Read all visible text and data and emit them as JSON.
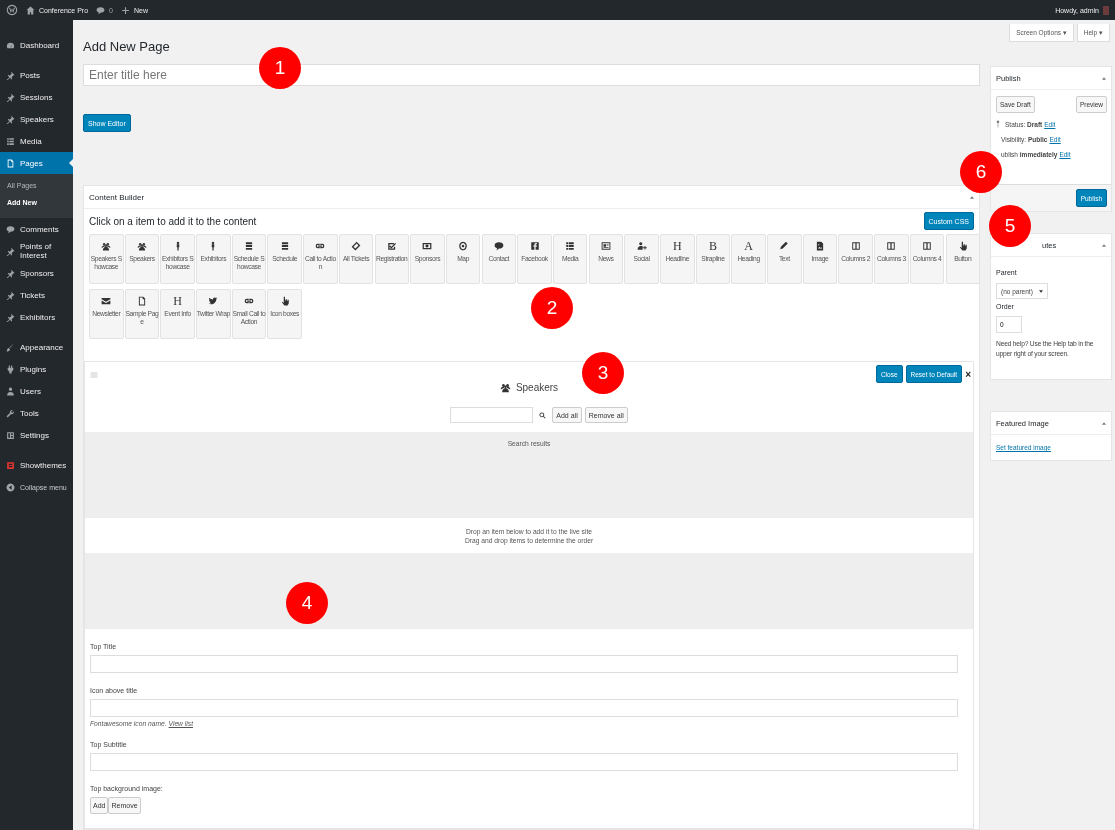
{
  "admin_bar": {
    "site": "Conference Pro",
    "comments": "0",
    "new": "New",
    "greeting": "Howdy, admin"
  },
  "sidebar": {
    "groups": [
      [
        {
          "label": "Dashboard",
          "selected": false
        }
      ],
      [
        {
          "label": "Posts",
          "selected": false
        },
        {
          "label": "Sessions",
          "selected": false
        },
        {
          "label": "Speakers",
          "selected": false
        },
        {
          "label": "Media",
          "selected": false
        },
        {
          "label": "Pages",
          "selected": true,
          "children": [
            {
              "label": "All Pages",
              "selected": false
            },
            {
              "label": "Add New",
              "selected": true
            }
          ]
        },
        {
          "label": "Comments",
          "selected": false
        },
        {
          "label": "Points of Interest",
          "selected": false
        },
        {
          "label": "Sponsors",
          "selected": false
        },
        {
          "label": "Tickets",
          "selected": false
        },
        {
          "label": "Exhibitors",
          "selected": false
        }
      ],
      [
        {
          "label": "Appearance",
          "selected": false
        },
        {
          "label": "Plugins",
          "selected": false
        },
        {
          "label": "Users",
          "selected": false
        },
        {
          "label": "Tools",
          "selected": false
        },
        {
          "label": "Settings",
          "selected": false
        }
      ],
      [
        {
          "label": "Showthemes",
          "selected": false
        },
        {
          "label": "Collapse menu",
          "selected": false
        }
      ]
    ]
  },
  "screen_tabs": [
    "Screen Options ▾",
    "Help ▾"
  ],
  "page_title": "Add New Page",
  "title_field": {
    "placeholder": "Enter title here"
  },
  "show_editor": "Show Editor",
  "content_builder": {
    "title": "Content Builder",
    "instruction": "Click on a item to add it to the content",
    "custom_css": "Custom CSS",
    "widget_rows": [
      [
        {
          "label": "Speakers Showcase"
        },
        {
          "label": "Speakers"
        },
        {
          "label": "Exhibitors Showcase"
        },
        {
          "label": "Exhibitors"
        },
        {
          "label": "Schedule Showcase"
        },
        {
          "label": "Schedule"
        },
        {
          "label": "Call to Action"
        },
        {
          "label": "All Tickets"
        },
        {
          "label": "Registration"
        },
        {
          "label": "Sponsors"
        },
        {
          "label": "Map"
        },
        {
          "label": "Contact"
        },
        {
          "label": "Facebook"
        },
        {
          "label": "Media"
        },
        {
          "label": "News"
        },
        {
          "label": "Social"
        },
        {
          "label": "Headline",
          "glyph": "H"
        },
        {
          "label": "Strapline",
          "glyph": "B"
        },
        {
          "label": "Heading",
          "glyph": "A"
        },
        {
          "label": "Text"
        },
        {
          "label": "Image"
        },
        {
          "label": "Columns 2"
        },
        {
          "label": "Columns 3"
        },
        {
          "label": "Columns 4"
        },
        {
          "label": "Button"
        }
      ],
      [
        {
          "label": "Newsletter"
        },
        {
          "label": "Sample Page"
        },
        {
          "label": "Event Info",
          "glyph": "H"
        },
        {
          "label": "Twitter Wrap"
        },
        {
          "label": "Small Call to Action"
        },
        {
          "label": "Icon boxes"
        }
      ]
    ],
    "module": {
      "title": "Speakers",
      "close": "Close",
      "reset": "Reset to Default",
      "dismiss": "×",
      "add_all": "Add all",
      "remove_all": "Remove all",
      "results_label": "Search results",
      "drop_hint": [
        "Drop an item below to add it to the live site",
        "Drag and drop items to determine the order"
      ],
      "fields": [
        {
          "label": "Top Title"
        },
        {
          "label": "Icon above title",
          "hint": "Fontawesome icon name.",
          "hint_link": "View list"
        },
        {
          "label": "Top Subtitle"
        }
      ],
      "image_label": "Top background image:",
      "image_buttons": [
        "Add",
        "Remove"
      ]
    }
  },
  "publish": {
    "title": "Publish",
    "save_draft": "Save Draft",
    "preview": "Preview",
    "rows": [
      {
        "text": "Status: **Draft**",
        "link": "Edit"
      },
      {
        "text": "Visibility: **Public**",
        "link": "Edit"
      },
      {
        "text": "ublish **immediately**",
        "link": "Edit"
      }
    ],
    "publish_button": "Publish"
  },
  "attributes": {
    "title": "utes",
    "parent_label": "Parent",
    "parent_value": "(no parent)",
    "order_label": "Order",
    "order_value": "0",
    "help": "Need help? Use the Help tab in the upper right of your screen."
  },
  "featured_image": {
    "title": "Featured Image",
    "link": "Set featured image"
  },
  "callouts": [
    {
      "number": "1"
    },
    {
      "number": "2"
    },
    {
      "number": "3"
    },
    {
      "number": "4"
    },
    {
      "number": "5"
    },
    {
      "number": "6"
    }
  ]
}
